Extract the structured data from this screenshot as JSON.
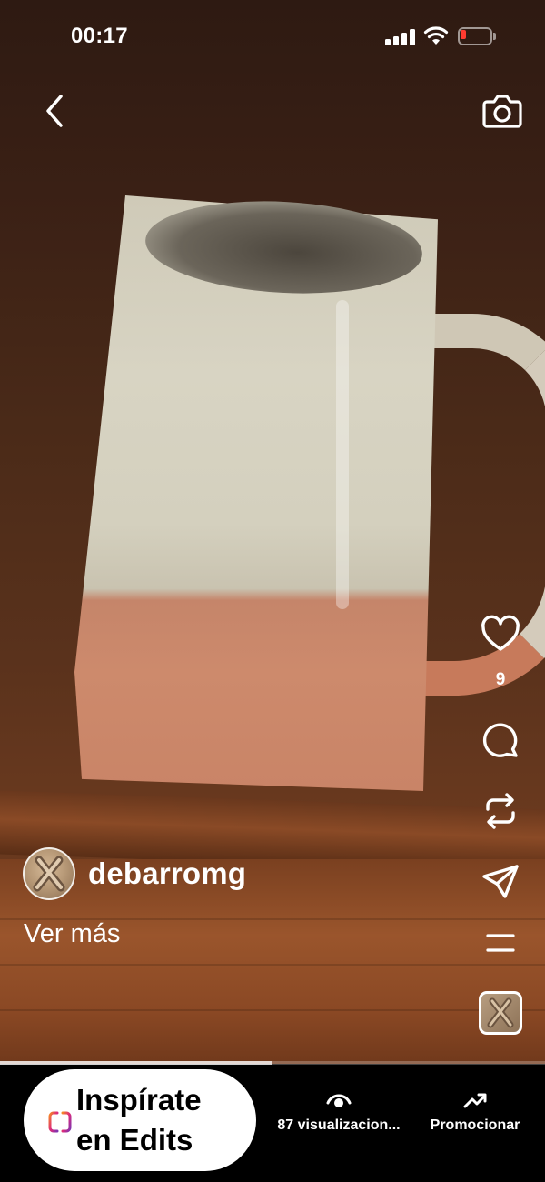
{
  "status_bar": {
    "time": "00:17",
    "battery_color": "#ff3b30"
  },
  "nav": {
    "back_icon": "chevron-left-icon",
    "camera_icon": "camera-icon"
  },
  "post": {
    "username": "debarromg",
    "see_more_label": "Ver más",
    "likes_count": "9",
    "video_progress_fraction": 0.5
  },
  "actions": {
    "icons": [
      "heart-icon",
      "comment-icon",
      "repost-icon",
      "send-icon",
      "menu-icon",
      "audio-thumbnail"
    ]
  },
  "bottom_bar": {
    "edits_label_line1": "Inspírate",
    "edits_label_line2": "en Edits",
    "views_label": "87 visualizacion...",
    "promote_label": "Promocionar"
  }
}
